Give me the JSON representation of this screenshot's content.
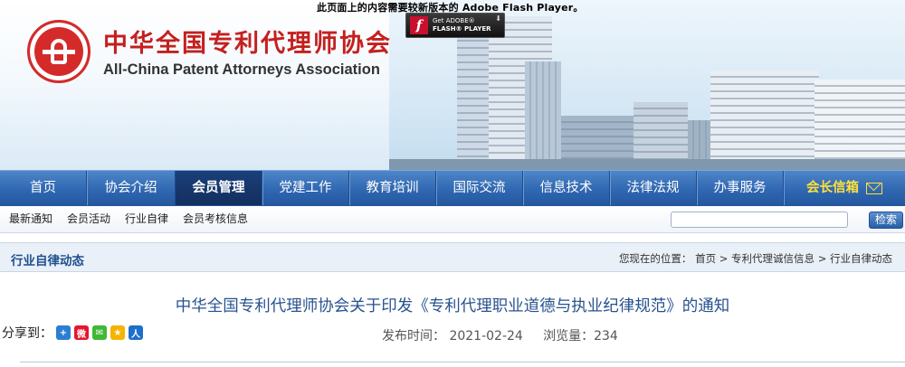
{
  "flash": {
    "notice": "此页面上的内容需要较新版本的 Adobe Flash Player。",
    "get": "Get ADOBE®",
    "product": "FLASH® PLAYER"
  },
  "site": {
    "title_cn": "中华全国专利代理师协会",
    "title_en": "All-China Patent Attorneys Association"
  },
  "nav": {
    "items": [
      {
        "label": "首页"
      },
      {
        "label": "协会介绍"
      },
      {
        "label": "会员管理"
      },
      {
        "label": "党建工作"
      },
      {
        "label": "教育培训"
      },
      {
        "label": "国际交流"
      },
      {
        "label": "信息技术"
      },
      {
        "label": "法律法规"
      },
      {
        "label": "办事服务"
      },
      {
        "label": "会长信箱"
      }
    ],
    "active": "会员管理"
  },
  "subnav": {
    "items": [
      {
        "label": "最新通知"
      },
      {
        "label": "会员活动"
      },
      {
        "label": "行业自律"
      },
      {
        "label": "会员考核信息"
      }
    ],
    "search_value": "",
    "search_button": "检索"
  },
  "section": {
    "title": "行业自律动态",
    "breadcrumb_prefix": "您现在的位置：",
    "crumbs": [
      "首页",
      "专利代理诚信信息",
      "行业自律动态"
    ],
    "separator": ">"
  },
  "article": {
    "title": "中华全国专利代理师协会关于印发《专利代理职业道德与执业纪律规范》的通知",
    "share_label": "分享到：",
    "publish_label": "发布时间：",
    "publish_date": "2021-02-24",
    "views_label": "浏览量：",
    "views": "234"
  },
  "colors": {
    "brand_red": "#c4201f",
    "nav_blue": "#2f67b1",
    "nav_active": "#132f5e",
    "title_blue": "#27528e",
    "mailbox_yellow": "#ffe03a"
  },
  "icons": [
    "add-share-icon",
    "weibo-icon",
    "wechat-icon",
    "qzone-icon",
    "renren-icon",
    "mail-icon"
  ]
}
